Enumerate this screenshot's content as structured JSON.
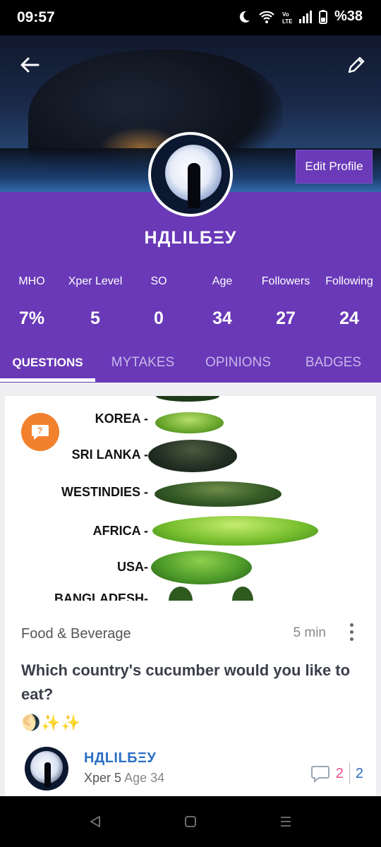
{
  "status_bar": {
    "time": "09:57",
    "battery": "%38",
    "icons": [
      "moon-icon",
      "wifi-icon",
      "volte-icon",
      "signal-icon",
      "battery-icon"
    ]
  },
  "header": {
    "back_icon": "arrow-left-icon",
    "edit_icon": "pencil-icon",
    "edit_profile_label": "Edit Profile"
  },
  "profile": {
    "username": "НДLILБΞУ",
    "stats": [
      {
        "label": "MHO",
        "value": "7%"
      },
      {
        "label": "Xper Level",
        "value": "5"
      },
      {
        "label": "SO",
        "value": "0"
      },
      {
        "label": "Age",
        "value": "34"
      },
      {
        "label": "Followers",
        "value": "27"
      },
      {
        "label": "Following",
        "value": "24"
      }
    ]
  },
  "tabs": [
    {
      "label": "QUESTIONS",
      "active": true
    },
    {
      "label": "MYTAKES",
      "active": false
    },
    {
      "label": "OPINIONS",
      "active": false
    },
    {
      "label": "BADGES",
      "active": false
    }
  ],
  "post": {
    "image_labels": [
      "KOREA -",
      "SRI LANKA -",
      "WESTINDIES -",
      "AFRICA -",
      "USA-",
      "BANGLADESH-"
    ],
    "category": "Food & Beverage",
    "time_ago": "5 min",
    "title": "Which country's cucumber would you like to eat?",
    "emojis": "🌖✨✨",
    "author": {
      "name": "НДLILБΞУ",
      "level": "Xper 5",
      "age": "Age 34"
    },
    "comment_count": "2",
    "opinion_count": "2"
  },
  "colors": {
    "brand_purple": "#6939b7",
    "badge_orange": "#f2812e",
    "link_blue": "#2b6fc3",
    "comment_pink": "#e0508a"
  }
}
